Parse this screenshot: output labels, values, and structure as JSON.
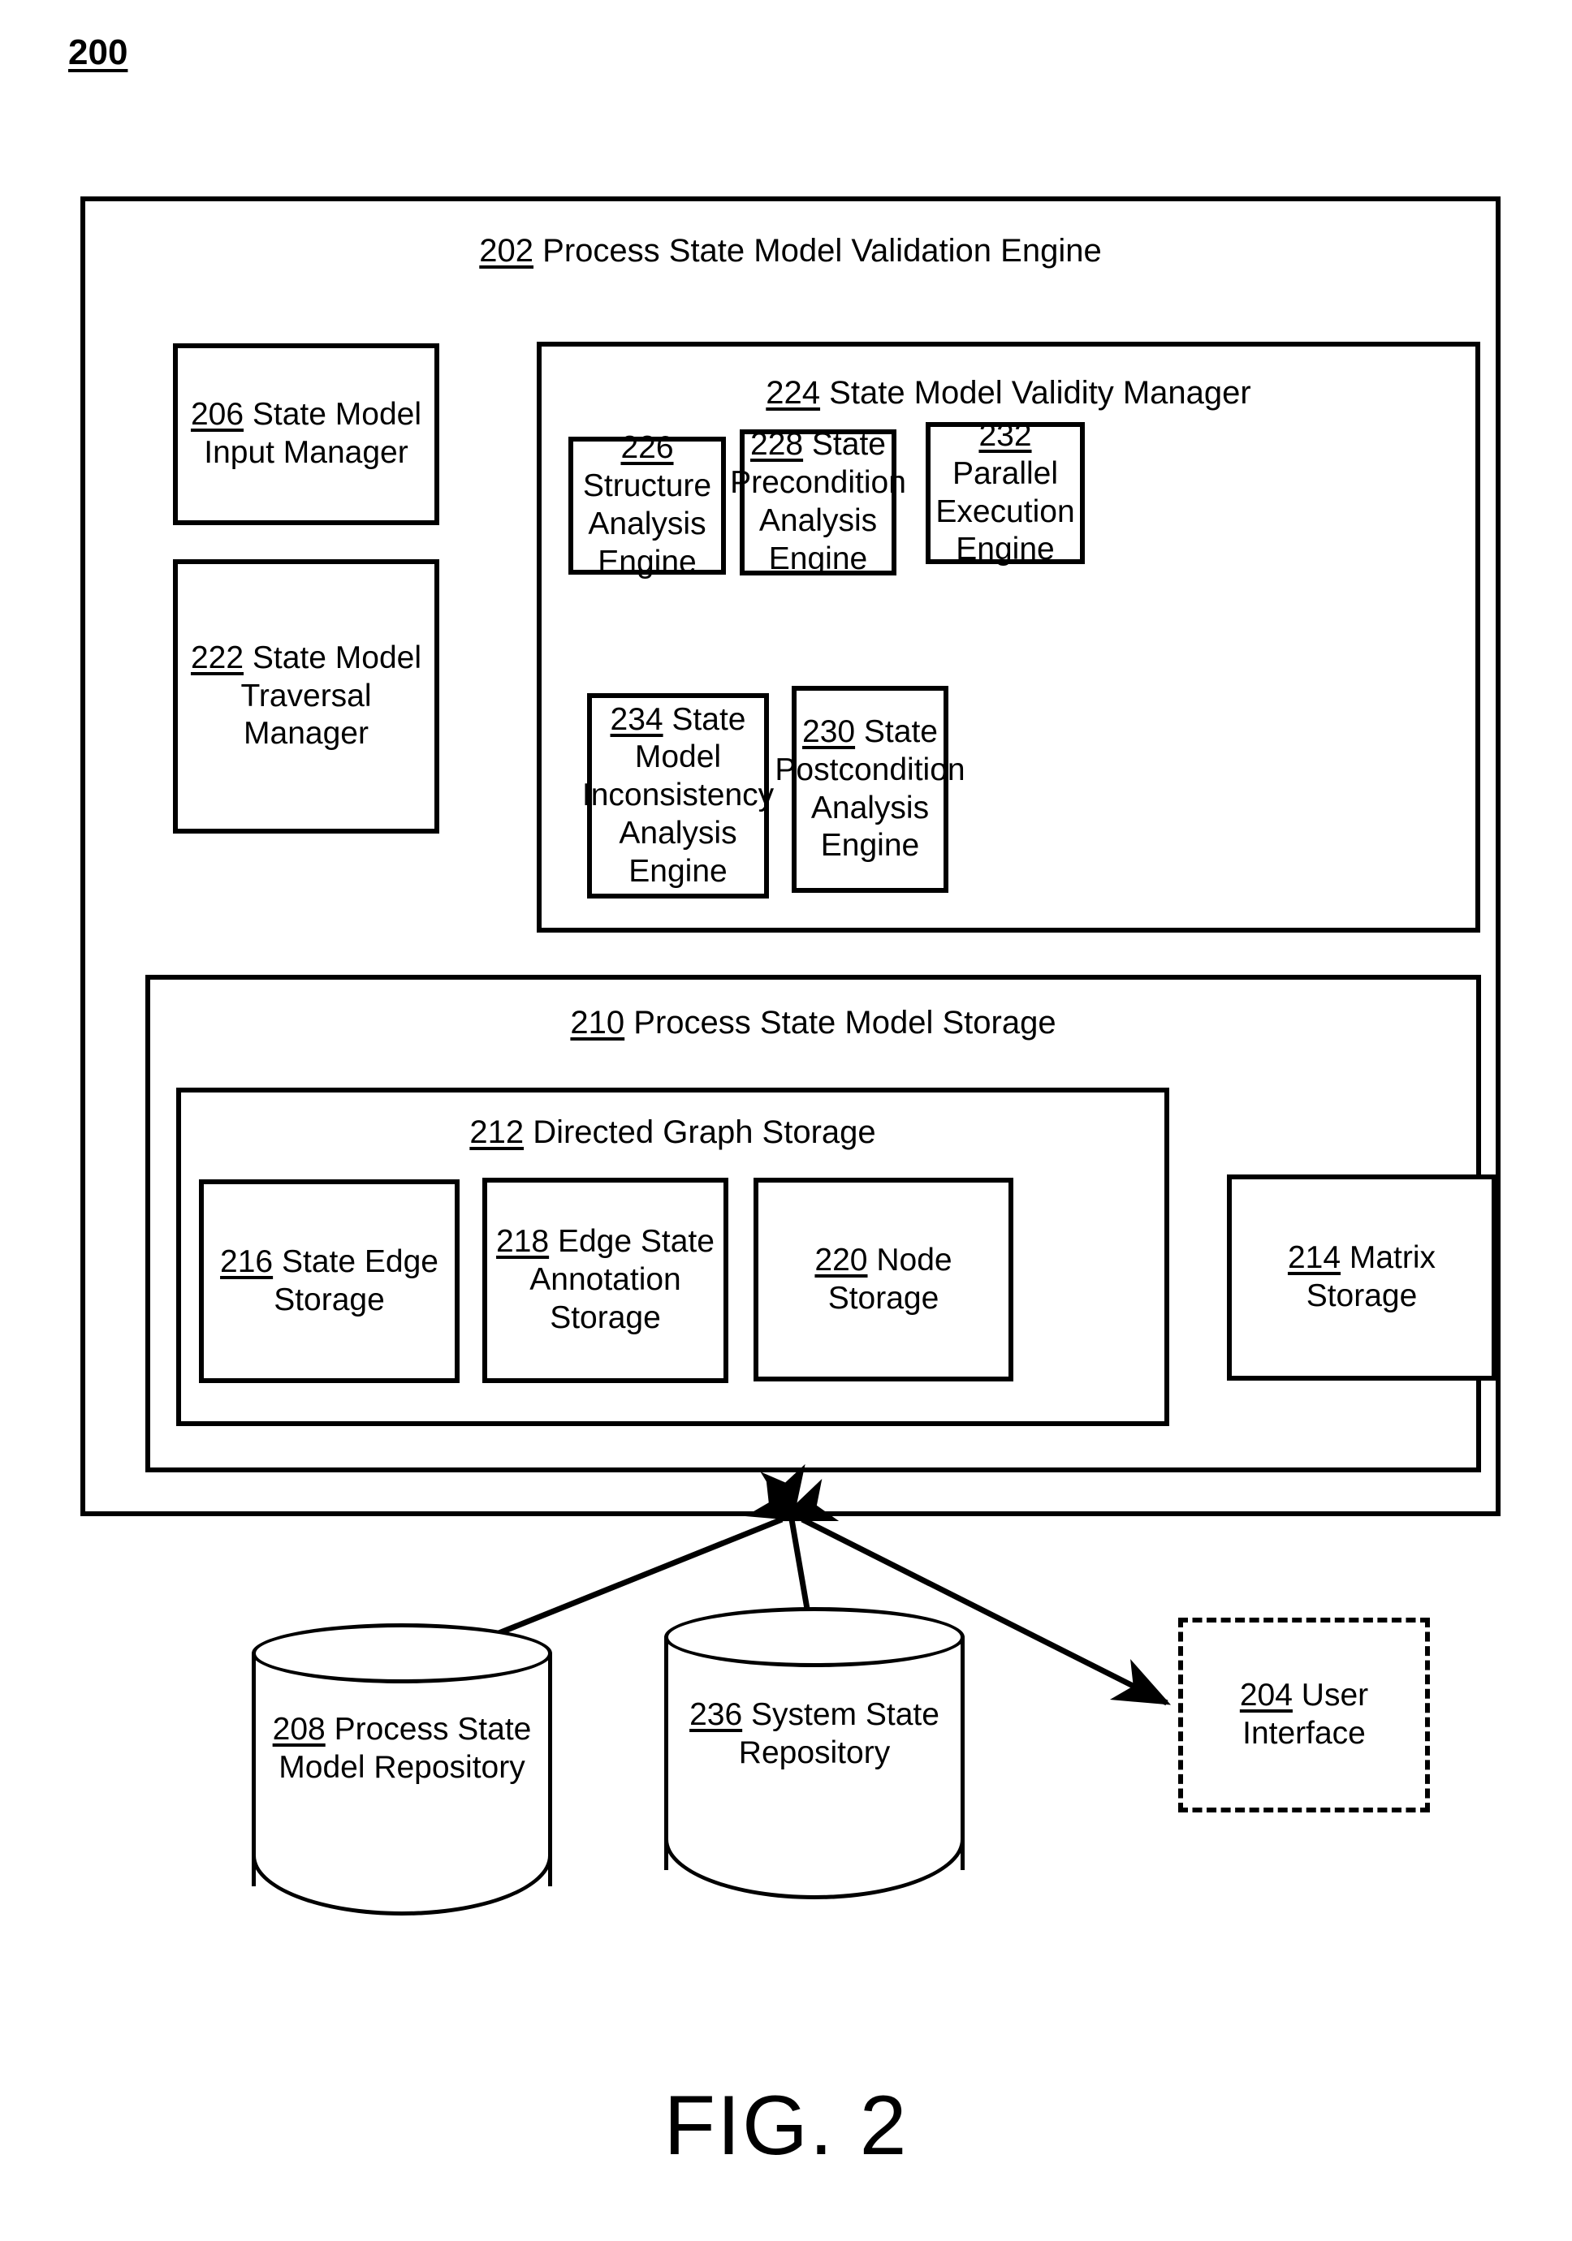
{
  "figure": {
    "number": "200",
    "caption": "FIG. 2"
  },
  "engine": {
    "ref": "202",
    "title": "Process State Model Validation Engine"
  },
  "left_column": [
    {
      "ref": "206",
      "title": "State Model Input Manager"
    },
    {
      "ref": "222",
      "title": "State Model Traversal Manager"
    }
  ],
  "validity_manager": {
    "ref": "224",
    "title": "State Model Validity Manager",
    "row1": [
      {
        "ref": "226",
        "title": "Structure Analysis Engine"
      },
      {
        "ref": "228",
        "title": "State Precondition Analysis Engine"
      },
      {
        "ref": "232",
        "title": "Parallel Execution Engine"
      }
    ],
    "row2": [
      {
        "ref": "234",
        "title": "State Model Inconsistency Analysis Engine"
      },
      {
        "ref": "230",
        "title": "State Postcondition Analysis Engine"
      }
    ]
  },
  "model_storage": {
    "ref": "210",
    "title": "Process State Model Storage",
    "graph_storage": {
      "ref": "212",
      "title": "Directed Graph Storage",
      "items": [
        {
          "ref": "216",
          "title": "State Edge Storage"
        },
        {
          "ref": "218",
          "title": "Edge State Annotation Storage"
        },
        {
          "ref": "220",
          "title": "Node Storage"
        }
      ]
    },
    "matrix_storage": {
      "ref": "214",
      "title": "Matrix Storage"
    }
  },
  "external": {
    "process_state_model_repository": {
      "ref": "208",
      "title": "Process State Model Repository"
    },
    "system_state_repository": {
      "ref": "236",
      "title": "System State Repository"
    },
    "user_interface": {
      "ref": "204",
      "title": "User Interface"
    }
  },
  "colors": {
    "stroke": "#000000",
    "background": "#ffffff"
  }
}
